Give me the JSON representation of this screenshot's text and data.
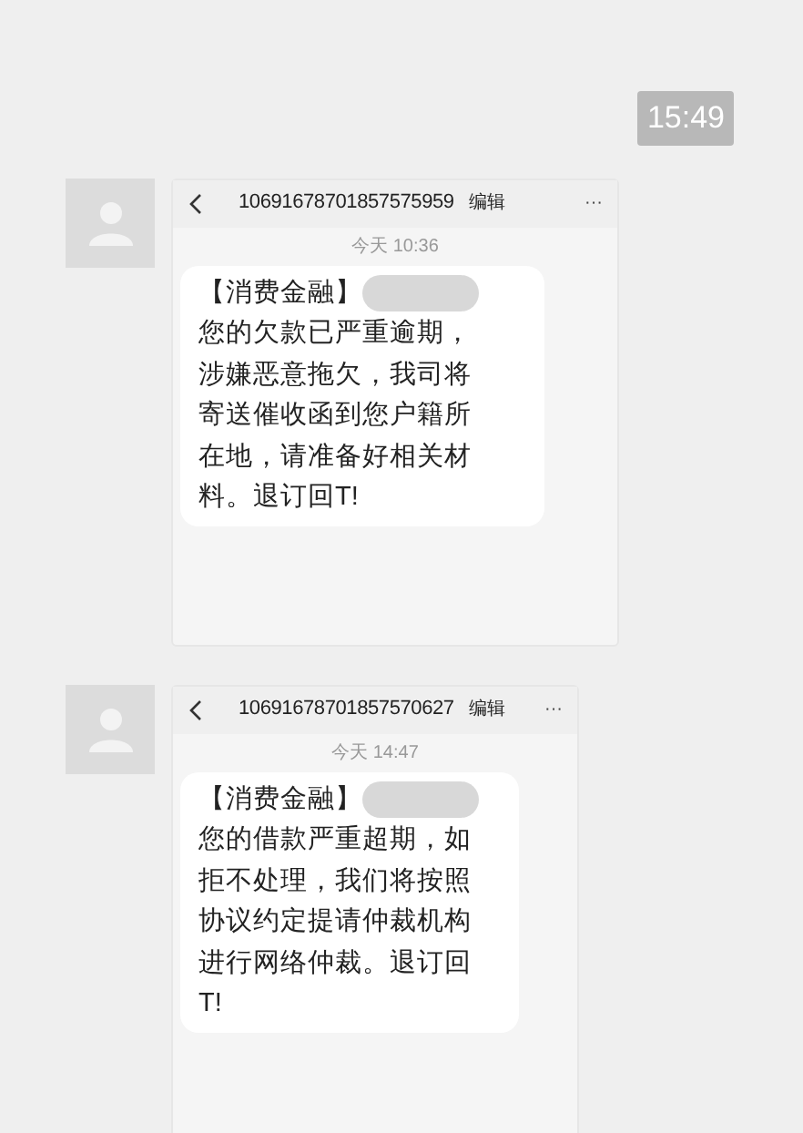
{
  "time_badge": "15:49",
  "messages": [
    {
      "sender": "10691678701857575959",
      "edit": "编辑",
      "more": "···",
      "date": "今天 10:36",
      "head": "【消费金融】",
      "redacted": true,
      "lines": [
        "您的欠款已严重逾期，",
        "涉嫌恶意拖欠，我司将",
        "寄送催收函到您户籍所",
        "在地，请准备好相关材",
        "料。退订回T!"
      ]
    },
    {
      "sender": "10691678701857570627",
      "edit": "编辑",
      "more": "···",
      "date": "今天 14:47",
      "head": "【消费金融】",
      "redacted": true,
      "lines": [
        "您的借款严重超期，如",
        "拒不处理，我们将按照",
        "协议约定提请仲裁机构",
        "进行网络仲裁。退订回",
        "T!"
      ]
    }
  ]
}
